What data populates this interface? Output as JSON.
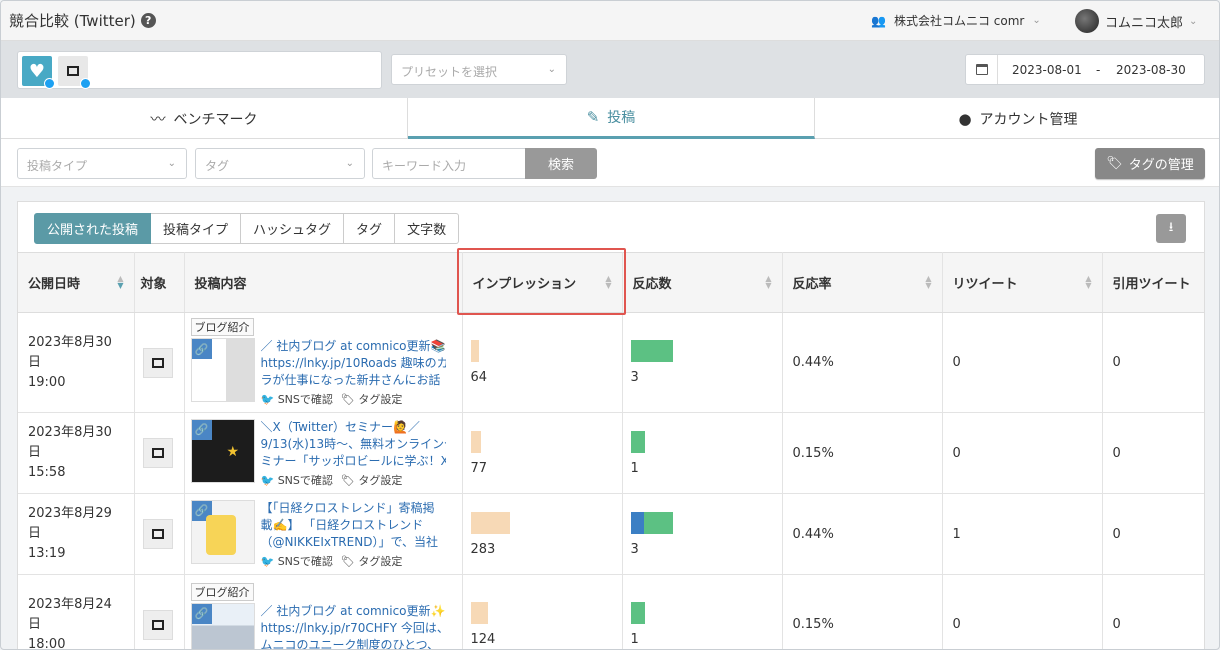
{
  "header": {
    "title": "競合比較 (Twitter)",
    "company": "株式会社コムニコ comr",
    "user": "コムニコ太郎"
  },
  "account_bar": {
    "preset_placeholder": "プリセットを選択",
    "date_from": "2023-08-01",
    "date_sep": "-",
    "date_to": "2023-08-30"
  },
  "main_tabs": [
    {
      "label": "ベンチマーク"
    },
    {
      "label": "投稿"
    },
    {
      "label": "アカウント管理"
    }
  ],
  "filters": {
    "post_type_placeholder": "投稿タイプ",
    "tag_placeholder": "タグ",
    "keyword_placeholder": "キーワード入力",
    "search_label": "検索",
    "tag_manage_label": "タグの管理"
  },
  "sub_tabs": [
    {
      "label": "公開された投稿"
    },
    {
      "label": "投稿タイプ"
    },
    {
      "label": "ハッシュタグ"
    },
    {
      "label": "タグ"
    },
    {
      "label": "文字数"
    }
  ],
  "table": {
    "headers": [
      "公開日時",
      "対象",
      "投稿内容",
      "インプレッション",
      "反応数",
      "反応率",
      "リツイート",
      "引用ツイート"
    ],
    "action_sns": "SNSで確認",
    "action_tag": "タグ設定",
    "rows": [
      {
        "date": "2023年8月30日",
        "time": "19:00",
        "label": "ブログ紹介",
        "lines": [
          "／ 社内ブログ at comnico更新📚 ＼",
          "https://lnky.jp/10Roads 趣味のカメ",
          "ラが仕事になった新井さんにお話"
        ],
        "impressions": "64",
        "impressions_value": 64,
        "reactions": "3",
        "reactions_value": 3,
        "reaction_rate": "0.44%",
        "retweets": "0",
        "quotes": "0"
      },
      {
        "date": "2023年8月30日",
        "time": "15:58",
        "label": "",
        "lines": [
          "＼X（Twitter）セミナー🙋／",
          "9/13(水)13時〜、無料オンラインセ",
          "ミナー「サッポロビールに学ぶ！X"
        ],
        "impressions": "77",
        "impressions_value": 77,
        "reactions": "1",
        "reactions_value": 1,
        "reaction_rate": "0.15%",
        "retweets": "0",
        "quotes": "0"
      },
      {
        "date": "2023年8月29日",
        "time": "13:19",
        "label": "",
        "lines": [
          "【「日経クロストレンド」寄稿掲",
          "載✍️】 「日経クロストレンド",
          "（@NIKKEIxTREND）」で、当社"
        ],
        "impressions": "283",
        "impressions_value": 283,
        "reactions": "3",
        "reactions_value": 3,
        "reaction_rate": "0.44%",
        "retweets": "1",
        "quotes": "0"
      },
      {
        "date": "2023年8月24日",
        "time": "18:00",
        "label": "ブログ紹介",
        "lines": [
          "／ 社内ブログ at comnico更新✨ ＼",
          "https://lnky.jp/r70CHFY 今回は、コ",
          "ムニコのユニーク制度のひとつ、"
        ],
        "impressions": "124",
        "impressions_value": 124,
        "reactions": "1",
        "reactions_value": 1,
        "reaction_rate": "0.15%",
        "retweets": "0",
        "quotes": "0"
      }
    ]
  },
  "colors": {
    "accent": "#5b9aa6",
    "impression_bar": "#f7d9b6",
    "reaction_bar": "#5cc183",
    "reaction_bar_alt": "#3b7fc4",
    "highlight": "#e0554f"
  },
  "icons": [
    "help-icon",
    "users-icon",
    "calendar-icon",
    "chart-line-icon",
    "edit-icon",
    "twitter-icon",
    "tag-icon",
    "download-icon",
    "link-icon",
    "sort-icon"
  ]
}
